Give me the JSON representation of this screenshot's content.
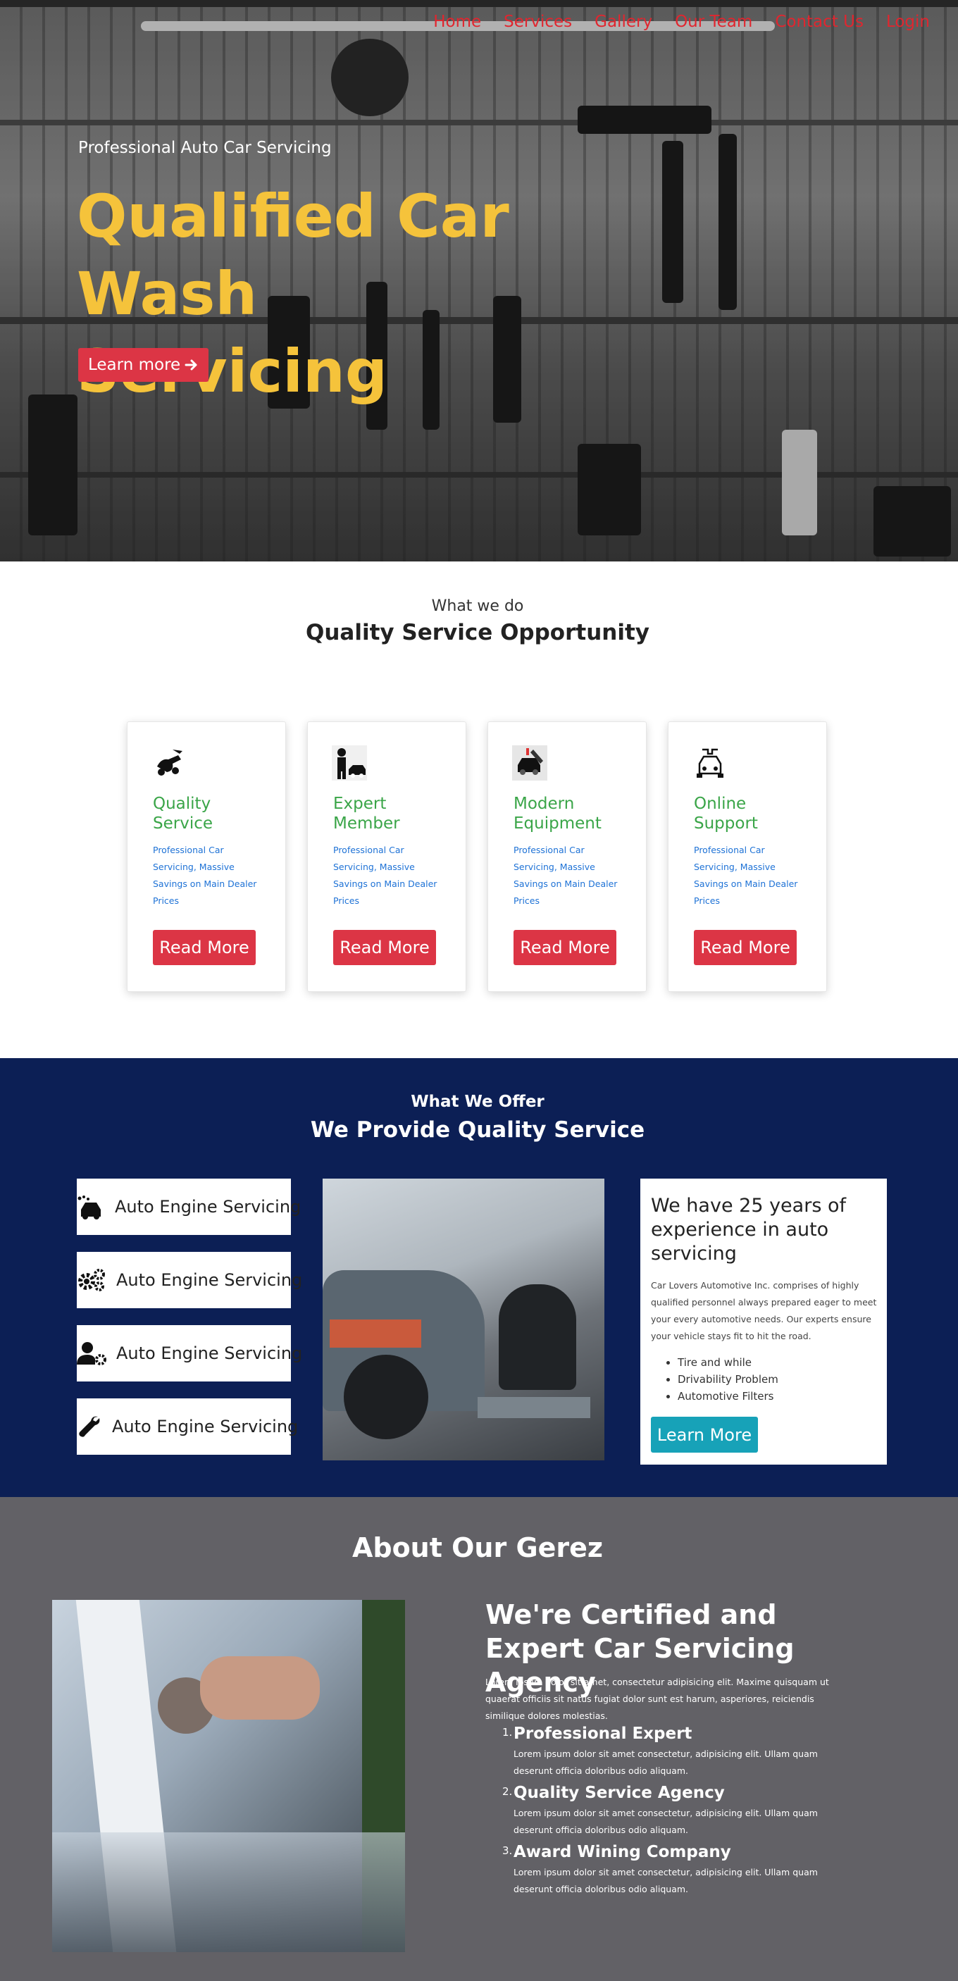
{
  "nav": {
    "items": [
      "Home",
      "Services",
      "Gallery",
      "Our Team",
      "Contact Us",
      "Login"
    ]
  },
  "hero": {
    "subtitle": "Professional Auto Car Servicing",
    "title": "Qualified Car Wash Servicing",
    "button_label": "Learn more",
    "button_icon": "arrow-right-icon"
  },
  "what_we_do": {
    "label": "What we do",
    "title": "Quality Service Opportunity",
    "cards": [
      {
        "title": "Quality Service",
        "text": "Professional Car Servicing, Massive Savings on Main Dealer Prices",
        "button": "Read More",
        "icon": "wrench-car-icon"
      },
      {
        "title": "Expert Member",
        "text": "Professional Car Servicing, Massive Savings on Main Dealer Prices",
        "button": "Read More",
        "icon": "mechanic-icon"
      },
      {
        "title": "Modern Equipment",
        "text": "Professional Car Servicing, Massive Savings on Main Dealer Prices",
        "button": "Read More",
        "icon": "equipment-icon"
      },
      {
        "title": "Online Support",
        "text": "Professional Car Servicing, Massive Savings on Main Dealer Prices",
        "button": "Read More",
        "icon": "car-support-icon"
      }
    ]
  },
  "offer": {
    "label": "What We Offer",
    "title": "We Provide Quality Service",
    "services": [
      {
        "label": "Auto Engine Servicing",
        "icon": "car-wash-icon"
      },
      {
        "label": "Auto Engine Servicing",
        "icon": "gears-icon"
      },
      {
        "label": "Auto Engine Servicing",
        "icon": "user-gear-icon"
      },
      {
        "label": "Auto Engine Servicing",
        "icon": "wrench-icon"
      }
    ],
    "experience": {
      "title": "We have 25 years of experience in auto servicing",
      "text": "Car Lovers Automotive Inc. comprises of highly qualified personnel always prepared eager to meet your every automotive needs. Our experts ensure your vehicle stays fit to hit the road.",
      "bullets": [
        "Tire and while",
        "Drivability Problem",
        "Automotive Filters"
      ],
      "button": "Learn More"
    }
  },
  "about": {
    "title": "About Our Gerez",
    "heading": "We're Certified and Expert Car Servicing Agency",
    "intro": "Lorem ipsum dolor sit amet, consectetur adipisicing elit. Maxime quisquam ut quaerat officiis sit natus fugiat dolor sunt est harum, asperiores, reiciendis similique dolores molestias.",
    "items": [
      {
        "num": "1.",
        "title": "Professional Expert",
        "text": "Lorem ipsum dolor sit amet consectetur, adipisicing elit. Ullam quam deserunt officia doloribus odio aliquam."
      },
      {
        "num": "2.",
        "title": "Quality Service Agency",
        "text": "Lorem ipsum dolor sit amet consectetur, adipisicing elit. Ullam quam deserunt officia doloribus odio aliquam."
      },
      {
        "num": "3.",
        "title": "Award Wining Company",
        "text": "Lorem ipsum dolor sit amet consectetur, adipisicing elit. Ullam quam deserunt officia doloribus odio aliquam."
      }
    ]
  },
  "colors": {
    "nav_link": "#e0262f",
    "hero_title": "#f5c33b",
    "primary_button": "#dc3545",
    "card_title": "#3aa548",
    "card_text": "#1e72d6",
    "offer_bg": "#0c1f55",
    "info_button": "#17a2b8",
    "about_bg": "#626166"
  }
}
